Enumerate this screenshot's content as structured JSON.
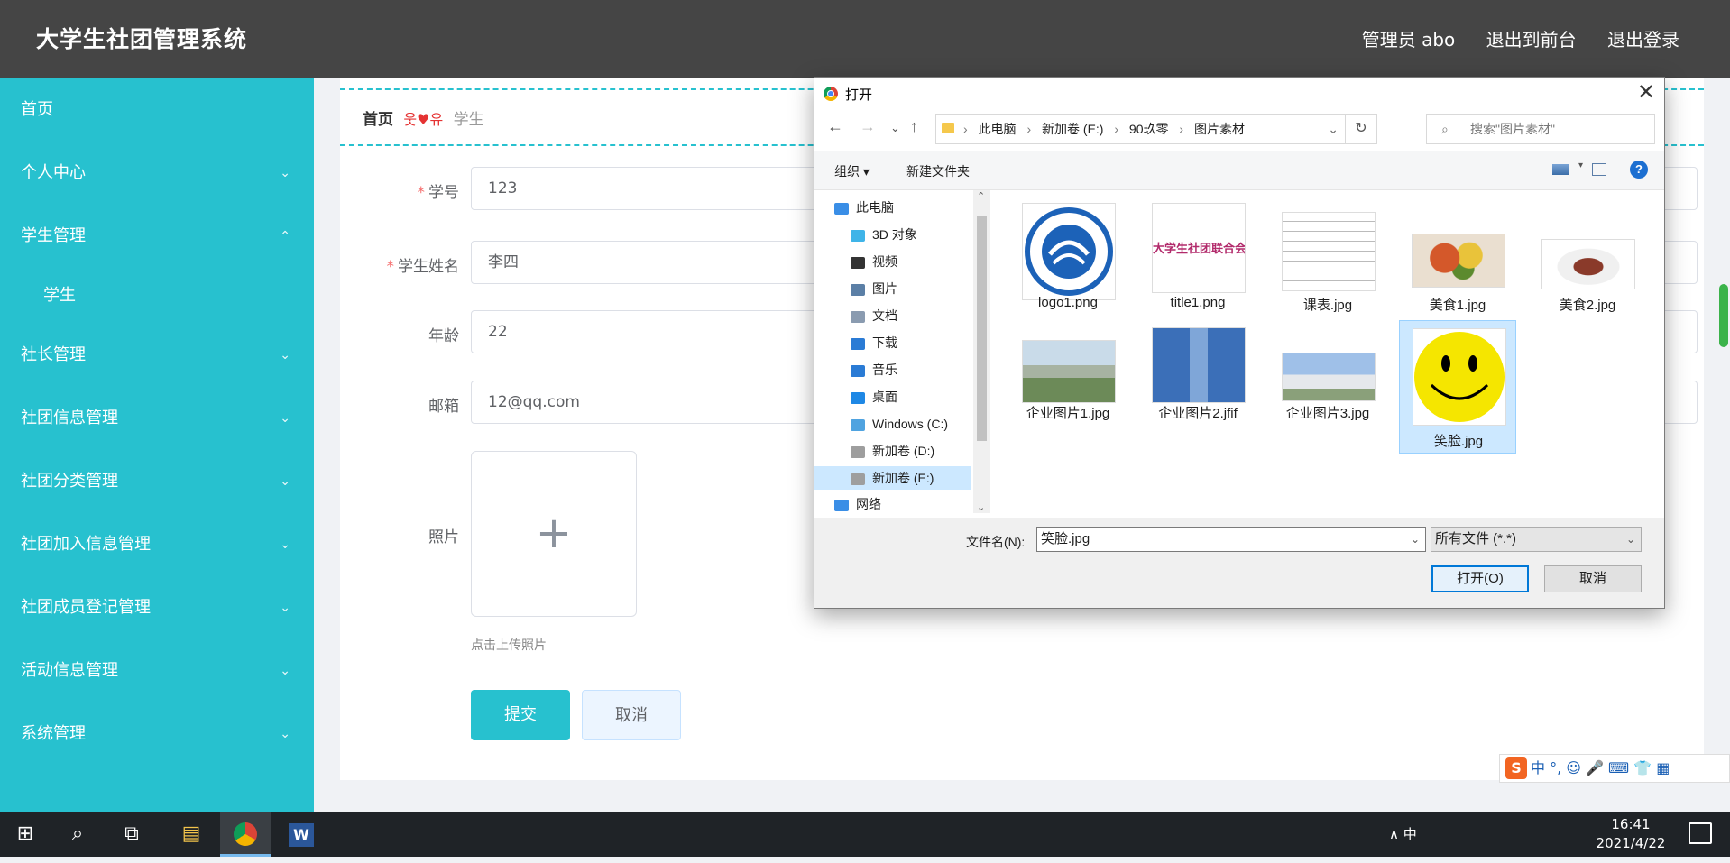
{
  "app": {
    "brand": "大学生社团管理系统",
    "header_links": [
      "管理员 abo",
      "退出到前台",
      "退出登录"
    ]
  },
  "sidebar": {
    "items": [
      {
        "label": "首页",
        "chevron": ""
      },
      {
        "label": "个人中心",
        "chevron": "⌄"
      },
      {
        "label": "学生管理",
        "chevron": "⌃"
      },
      {
        "label": "学生",
        "chevron": ""
      },
      {
        "label": "社长管理",
        "chevron": "⌄"
      },
      {
        "label": "社团信息管理",
        "chevron": "⌄"
      },
      {
        "label": "社团分类管理",
        "chevron": "⌄"
      },
      {
        "label": "社团加入信息管理",
        "chevron": "⌄"
      },
      {
        "label": "社团成员登记管理",
        "chevron": "⌄"
      },
      {
        "label": "活动信息管理",
        "chevron": "⌄"
      },
      {
        "label": "系统管理",
        "chevron": "⌄"
      }
    ]
  },
  "breadcrumb": {
    "home": "首页",
    "sep": "웃♥유",
    "current": "学生"
  },
  "form": {
    "fields": [
      {
        "label": "学号",
        "required": "*",
        "value": "123"
      },
      {
        "label": "学生姓名",
        "required": "*",
        "value": "李四"
      },
      {
        "label": "年龄",
        "required": "",
        "value": "22"
      },
      {
        "label": "邮箱",
        "required": "",
        "value": "12@qq.com"
      }
    ],
    "photo_label": "照片",
    "upload_plus": "+",
    "upload_hint": "点击上传照片",
    "submit": "提交",
    "cancel": "取消"
  },
  "dialog": {
    "title": "打开",
    "close": "✕",
    "nav": {
      "back": "←",
      "forward": "→",
      "recent": "⌄",
      "up": "↑"
    },
    "path": [
      "此电脑",
      "新加卷 (E:)",
      "90玖零",
      "图片素材"
    ],
    "path_sep": "›",
    "address_dropdown": "⌄",
    "refresh": "↻",
    "search_placeholder": "搜索\"图片素材\"",
    "search_icon": "⌕",
    "organize": "组织 ▾",
    "new_folder": "新建文件夹",
    "view_dropdown": "▾",
    "help": "?",
    "tree": [
      {
        "label": "此电脑",
        "icon": "computer-icon",
        "color": "#3a8ee6"
      },
      {
        "label": "3D 对象",
        "icon": "cube-icon",
        "color": "#3fb4e8"
      },
      {
        "label": "视频",
        "icon": "film-icon",
        "color": "#333333"
      },
      {
        "label": "图片",
        "icon": "picture-icon",
        "color": "#5b7fa6"
      },
      {
        "label": "文档",
        "icon": "document-icon",
        "color": "#8a9bb0"
      },
      {
        "label": "下载",
        "icon": "download-icon",
        "color": "#2a7bd5"
      },
      {
        "label": "音乐",
        "icon": "music-icon",
        "color": "#2a7bd5"
      },
      {
        "label": "桌面",
        "icon": "desktop-icon",
        "color": "#1e88e5"
      },
      {
        "label": "Windows (C:)",
        "icon": "drive-icon",
        "color": "#4fa3e0"
      },
      {
        "label": "新加卷 (D:)",
        "icon": "drive-icon",
        "color": "#9e9e9e"
      },
      {
        "label": "新加卷 (E:)",
        "icon": "drive-icon",
        "color": "#9e9e9e"
      },
      {
        "label": "网络",
        "icon": "network-icon",
        "color": "#3a8ee6"
      }
    ],
    "tree_scroll_up": "⌃",
    "tree_scroll_down": "⌄",
    "files": [
      {
        "name": "logo1.png",
        "thumb": "logo"
      },
      {
        "name": "title1.png",
        "thumb": "title"
      },
      {
        "name": "课表.jpg",
        "thumb": "table"
      },
      {
        "name": "美食1.jpg",
        "thumb": "food"
      },
      {
        "name": "美食2.jpg",
        "thumb": "food2"
      },
      {
        "name": "企业图片1.jpg",
        "thumb": "building"
      },
      {
        "name": "企业图片2.jfif",
        "thumb": "tower"
      },
      {
        "name": "企业图片3.jpg",
        "thumb": "building2"
      },
      {
        "name": "笑脸.jpg",
        "thumb": "smiley"
      }
    ],
    "title_thumb_text": "大学生社团联合会",
    "filename_label": "文件名(N):",
    "filename_value": "笑脸.jpg",
    "filetype_value": "所有文件 (*.*)",
    "open_button": "打开(O)",
    "cancel_button": "取消",
    "dropdown": "⌄"
  },
  "ime": {
    "logo": "S",
    "text": "中 °, ☺ 🎤 ⌨ 👕 ▦"
  },
  "taskbar": {
    "tray": "∧  中",
    "time": "16:41",
    "date": "2021/4/22",
    "start": "⊞",
    "search": "⌕",
    "taskview": "⧉",
    "explorer": "▤",
    "word": "W"
  },
  "colors": {
    "accent": "#27c1cf",
    "header": "#454545",
    "selected": "#cce8ff"
  }
}
